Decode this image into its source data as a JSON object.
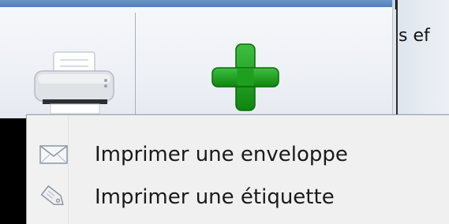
{
  "background_app": {
    "text": "s ef"
  },
  "ribbon": {
    "print_button_icon": "printer-icon",
    "add_button_icon": "plus-icon",
    "accent_color": "#1a8f1a"
  },
  "menu": {
    "items": [
      {
        "label": "Imprimer une enveloppe",
        "icon": "envelope-icon"
      },
      {
        "label": "Imprimer une étiquette",
        "icon": "tag-icon"
      }
    ]
  }
}
